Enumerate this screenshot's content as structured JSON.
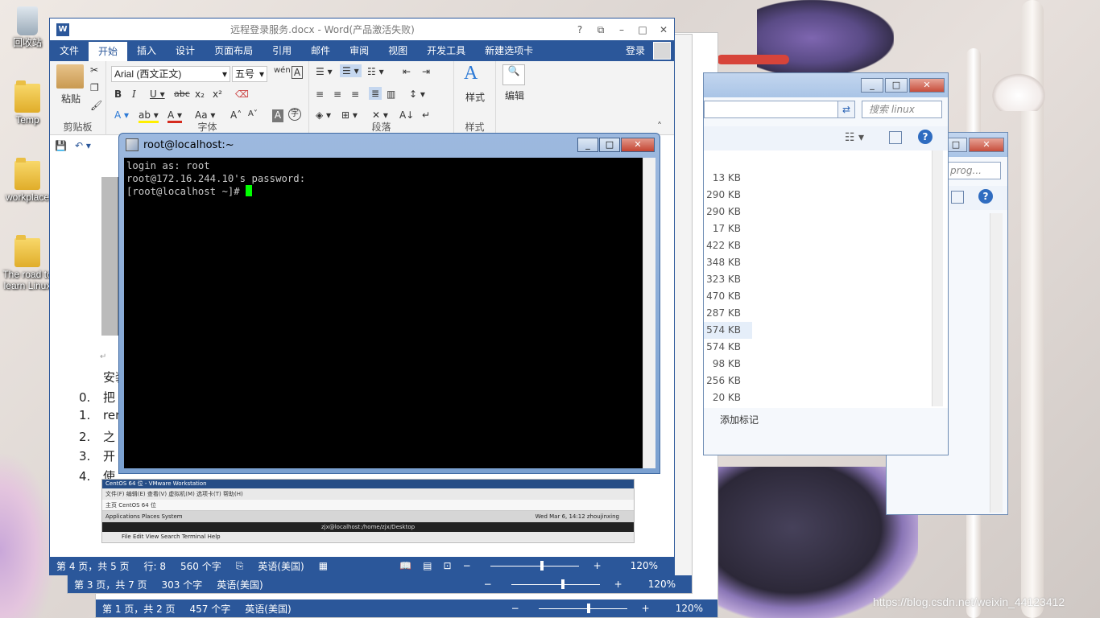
{
  "desktop": {
    "icons": [
      "回收站",
      "Temp",
      "workplace",
      "The road to learn Linux"
    ],
    "watermark": "https://blog.csdn.net/weixin_44123412"
  },
  "word_main": {
    "title": "远程登录服务.docx - Word(产品激活失败)",
    "menu": [
      "文件",
      "开始",
      "插入",
      "设计",
      "页面布局",
      "引用",
      "邮件",
      "审阅",
      "视图",
      "开发工具",
      "新建选项卡"
    ],
    "login": "登录",
    "ribbon": {
      "paste": "粘贴",
      "clipboard_group": "剪贴板",
      "font_name": "Arial (西文正文)",
      "font_size": "五号",
      "font_group": "字体",
      "paragraph_group": "段落",
      "styles": "样式",
      "styles_group": "样式",
      "editing": "编辑"
    },
    "doc": {
      "lines": [
        {
          "num": "",
          "text": "安装 ss"
        },
        {
          "num": "0.",
          "text": "把"
        },
        {
          "num": "1.",
          "text": "ren"
        },
        {
          "num": "2.",
          "text": "之"
        },
        {
          "num": "3.",
          "text": "开"
        },
        {
          "num": "4.",
          "text": "使"
        }
      ],
      "vm": {
        "title": "CentOS 64 位 - VMware Workstation",
        "menu": "文件(F)  编辑(E)  查看(V)  虚拟机(M)  选项卡(T)  帮助(H)",
        "tabs": "主页   CentOS 64 位",
        "apps": "Applications   Places   System",
        "clock": "Wed Mar 6, 14:12   zhoujinxing",
        "term_title": "zjx@localhost:/home/zjx/Desktop",
        "term_menu": "File   Edit   View   Search   Terminal   Help"
      }
    },
    "status": {
      "page": "第 4 页，共 5 页",
      "line": "行: 8",
      "words": "560 个字",
      "lang": "英语(美国)",
      "zoom": "120%"
    }
  },
  "word_back1": {
    "status": {
      "page": "第 3 页，共 7 页",
      "words": "303 个字",
      "lang": "英语(美国)",
      "zoom": "120%"
    }
  },
  "word_back2": {
    "status": {
      "page": "第 1 页，共 2 页",
      "words": "457 个字",
      "lang": "英语(美国)",
      "zoom": "120%"
    }
  },
  "explorer1": {
    "search": "搜索 linux",
    "sizes": [
      "13 KB",
      "290 KB",
      "290 KB",
      "17 KB",
      "422 KB",
      "348 KB",
      "323 KB",
      "470 KB",
      "287 KB",
      "574 KB",
      "574 KB",
      "98 KB",
      "256 KB",
      "20 KB"
    ],
    "footer": "添加标记"
  },
  "explorer2": {
    "search": "prog..."
  },
  "putty": {
    "title": "root@localhost:~",
    "lines": [
      "login as: root",
      "root@172.16.244.10's password:",
      "[root@localhost ~]# "
    ]
  }
}
